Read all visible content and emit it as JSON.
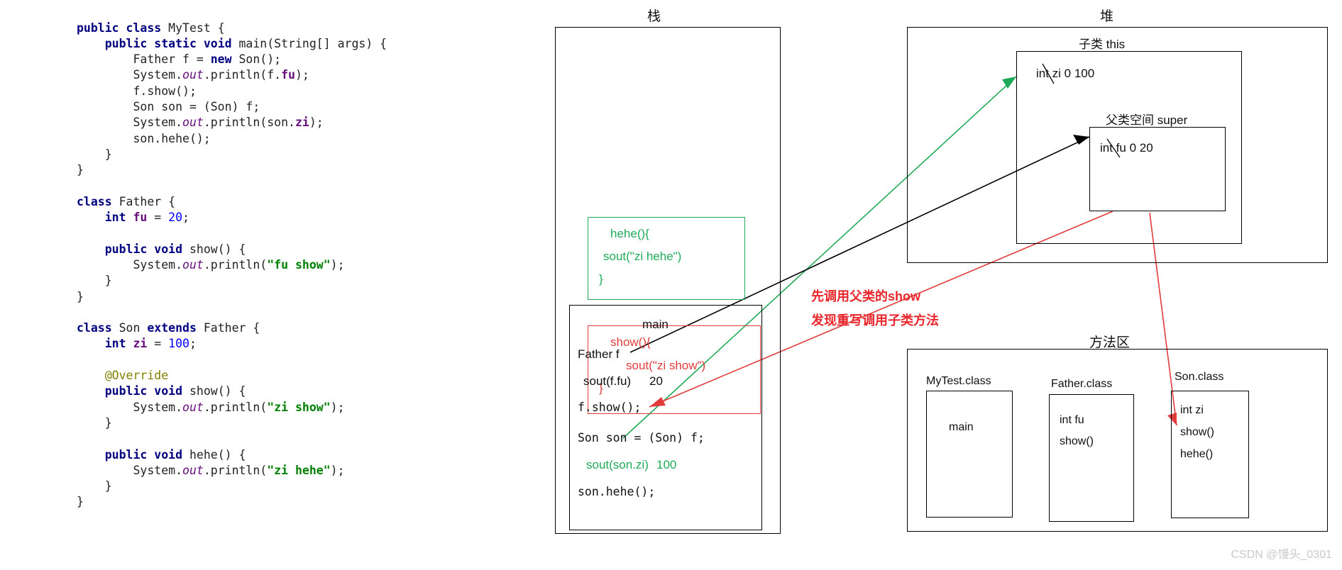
{
  "code": {
    "lines": [
      [
        {
          "t": "public ",
          "c": "k"
        },
        {
          "t": "class ",
          "c": "k"
        },
        {
          "t": "MyTest {",
          "c": "ty"
        }
      ],
      [
        {
          "t": "    public ",
          "c": "k"
        },
        {
          "t": "static ",
          "c": "k"
        },
        {
          "t": "void ",
          "c": "k"
        },
        {
          "t": "main(String[] args) {",
          "c": "ty"
        }
      ],
      [
        {
          "t": "        Father f = ",
          "c": "ty"
        },
        {
          "t": "new ",
          "c": "k"
        },
        {
          "t": "Son();",
          "c": "ty"
        }
      ],
      [
        {
          "t": "        System.",
          "c": "ty"
        },
        {
          "t": "out",
          "c": "it"
        },
        {
          "t": ".println(f.",
          "c": "ty"
        },
        {
          "t": "fu",
          "c": "fld"
        },
        {
          "t": ");",
          "c": "ty"
        }
      ],
      [
        {
          "t": "        f.show();",
          "c": "ty"
        }
      ],
      [
        {
          "t": "        Son son = (Son) f;",
          "c": "ty"
        }
      ],
      [
        {
          "t": "        System.",
          "c": "ty"
        },
        {
          "t": "out",
          "c": "it"
        },
        {
          "t": ".println(son.",
          "c": "ty"
        },
        {
          "t": "zi",
          "c": "fld"
        },
        {
          "t": ");",
          "c": "ty"
        }
      ],
      [
        {
          "t": "        son.hehe();",
          "c": "ty"
        }
      ],
      [
        {
          "t": "    }",
          "c": "ty"
        }
      ],
      [
        {
          "t": "}",
          "c": "ty"
        }
      ],
      [
        {
          "t": "",
          "c": "ty"
        }
      ],
      [
        {
          "t": "class ",
          "c": "k"
        },
        {
          "t": "Father {",
          "c": "ty"
        }
      ],
      [
        {
          "t": "    int ",
          "c": "k"
        },
        {
          "t": "fu",
          "c": "fld"
        },
        {
          "t": " = ",
          "c": "ty"
        },
        {
          "t": "20",
          "c": "num"
        },
        {
          "t": ";",
          "c": "ty"
        }
      ],
      [
        {
          "t": "",
          "c": "ty"
        }
      ],
      [
        {
          "t": "    public ",
          "c": "k"
        },
        {
          "t": "void ",
          "c": "k"
        },
        {
          "t": "show() {",
          "c": "ty"
        }
      ],
      [
        {
          "t": "        System.",
          "c": "ty"
        },
        {
          "t": "out",
          "c": "it"
        },
        {
          "t": ".println(",
          "c": "ty"
        },
        {
          "t": "\"fu show\"",
          "c": "str"
        },
        {
          "t": ");",
          "c": "ty"
        }
      ],
      [
        {
          "t": "    }",
          "c": "ty"
        }
      ],
      [
        {
          "t": "}",
          "c": "ty"
        }
      ],
      [
        {
          "t": "",
          "c": "ty"
        }
      ],
      [
        {
          "t": "class ",
          "c": "k"
        },
        {
          "t": "Son ",
          "c": "ty"
        },
        {
          "t": "extends ",
          "c": "k"
        },
        {
          "t": "Father {",
          "c": "ty"
        }
      ],
      [
        {
          "t": "    int ",
          "c": "k"
        },
        {
          "t": "zi",
          "c": "fld"
        },
        {
          "t": " = ",
          "c": "ty"
        },
        {
          "t": "100",
          "c": "num"
        },
        {
          "t": ";",
          "c": "ty"
        }
      ],
      [
        {
          "t": "",
          "c": "ty"
        }
      ],
      [
        {
          "t": "    @Override",
          "c": "an"
        }
      ],
      [
        {
          "t": "    public ",
          "c": "k"
        },
        {
          "t": "void ",
          "c": "k"
        },
        {
          "t": "show() {",
          "c": "ty"
        }
      ],
      [
        {
          "t": "        System.",
          "c": "ty"
        },
        {
          "t": "out",
          "c": "it"
        },
        {
          "t": ".println(",
          "c": "ty"
        },
        {
          "t": "\"zi show\"",
          "c": "str"
        },
        {
          "t": ");",
          "c": "ty"
        }
      ],
      [
        {
          "t": "    }",
          "c": "ty"
        }
      ],
      [
        {
          "t": "",
          "c": "ty"
        }
      ],
      [
        {
          "t": "    public ",
          "c": "k"
        },
        {
          "t": "void ",
          "c": "k"
        },
        {
          "t": "hehe() {",
          "c": "ty"
        }
      ],
      [
        {
          "t": "        System.",
          "c": "ty"
        },
        {
          "t": "out",
          "c": "it"
        },
        {
          "t": ".println(",
          "c": "ty"
        },
        {
          "t": "\"zi hehe\"",
          "c": "str"
        },
        {
          "t": ");",
          "c": "ty"
        }
      ],
      [
        {
          "t": "    }",
          "c": "ty"
        }
      ],
      [
        {
          "t": "}",
          "c": "ty"
        }
      ]
    ]
  },
  "stack": {
    "title": "栈",
    "hehe_frame": {
      "line1": "hehe(){",
      "line2": "sout(\"zi hehe\")",
      "line3": "}",
      "color": "#1faa59"
    },
    "show_frame": {
      "line1": "show(){",
      "line2": "sout(\"zi show\")",
      "line3": "}",
      "color": "#e23b3b"
    },
    "main_frame": {
      "title": "main",
      "father_ref": "Father f",
      "sout_fu": "sout(f.fu)",
      "fu_value": "20",
      "call_show": "f.show();",
      "cast_line": "Son son = (Son) f;",
      "sout_zi": "sout(son.zi)",
      "zi_value": "100",
      "call_hehe": "son.hehe();"
    }
  },
  "heap": {
    "title": "堆",
    "this_box": {
      "title": "子类 this",
      "field": "int zi 0 100"
    },
    "super_box": {
      "title": "父类空间 super",
      "field": "int fu 0  20"
    }
  },
  "annotation": {
    "line1": "先调用父类的show",
    "line2": "发现重写调用子类方法",
    "color": "#e8262b"
  },
  "method_area": {
    "title": "方法区",
    "classes": [
      {
        "name": "MyTest.class",
        "members": [
          "main"
        ]
      },
      {
        "name": "Father.class",
        "members": [
          "int fu",
          "show()"
        ]
      },
      {
        "name": "Son.class",
        "members": [
          "int zi",
          "show()",
          "hehe()"
        ]
      }
    ]
  },
  "watermark": "CSDN @馒头_0301"
}
